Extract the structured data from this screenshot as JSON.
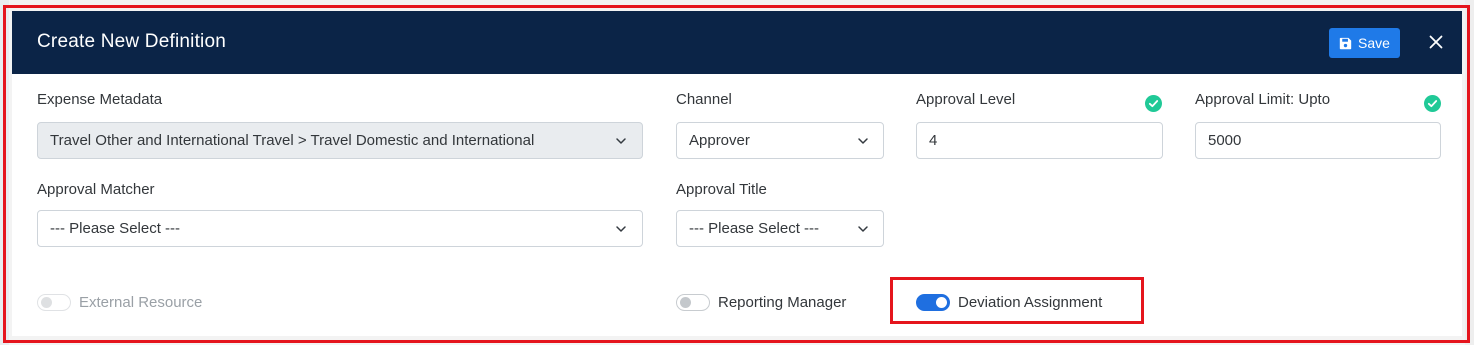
{
  "modal": {
    "title": "Create New Definition",
    "save_label": "Save",
    "accent_color": "#1f7ae8",
    "header_color": "#0b2447"
  },
  "fields": {
    "expense_metadata": {
      "label": "Expense Metadata",
      "value": "Travel Other and International Travel > Travel Domestic and International"
    },
    "channel": {
      "label": "Channel",
      "value": "Approver"
    },
    "approval_level": {
      "label": "Approval Level",
      "value": "4"
    },
    "approval_limit": {
      "label": "Approval Limit: Upto",
      "value": "5000"
    },
    "approval_matcher": {
      "label": "Approval Matcher",
      "value": "--- Please Select ---"
    },
    "approval_title": {
      "label": "Approval Title",
      "value": "--- Please Select ---"
    }
  },
  "toggles": {
    "external_resource": {
      "label": "External Resource",
      "checked": false,
      "disabled": true
    },
    "reporting_manager": {
      "label": "Reporting Manager",
      "checked": false,
      "disabled": false
    },
    "deviation_assignment": {
      "label": "Deviation Assignment",
      "checked": true,
      "disabled": false
    }
  },
  "icons": {
    "save": "floppy-disk-icon",
    "close": "close-icon",
    "check": "check-circle-icon",
    "chevron": "chevron-down-icon"
  },
  "colors": {
    "highlight": "#e5151d",
    "check": "#20c997",
    "toggle_on": "#1f6fe0"
  }
}
